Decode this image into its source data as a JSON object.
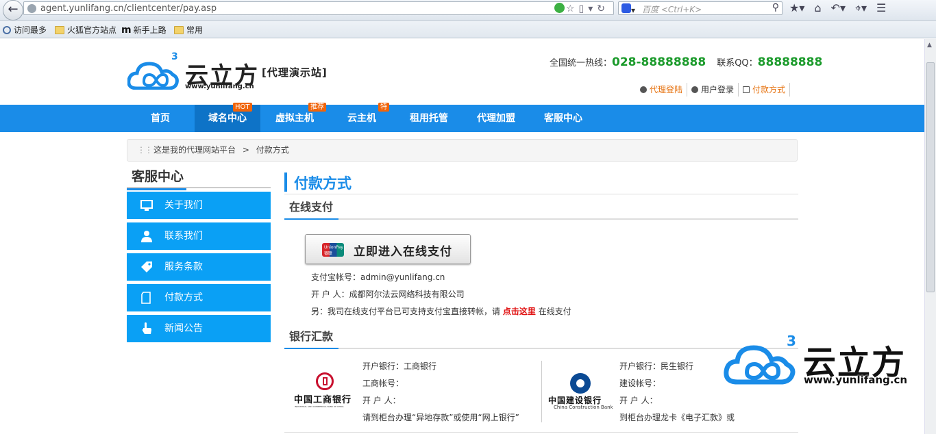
{
  "browser": {
    "url": "agent.yunlifang.cn/clientcenter/pay.asp",
    "search_placeholder": "百度 <Ctrl+K>",
    "bookmarks": [
      "访问最多",
      "火狐官方站点",
      "新手上路",
      "常用"
    ]
  },
  "header": {
    "logo_text": "云立方",
    "logo_url": "www.yunlifang.cn",
    "logo_superscript": "3",
    "tagline": "[代理演示站]",
    "hotline_label": "全国统一热线：",
    "hotline_number": "028-88888888",
    "qq_label": "联系QQ：",
    "qq_number": "88888888",
    "links": [
      "代理登陆",
      "用户登录",
      "付款方式"
    ]
  },
  "nav": {
    "items": [
      "首页",
      "域名中心",
      "虚拟主机",
      "云主机",
      "租用托管",
      "代理加盟",
      "客服中心"
    ],
    "badges": {
      "domain": "HOT",
      "vhost": "推荐",
      "cloud": "特"
    }
  },
  "breadcrumb": {
    "root": "这是我的代理网站平台",
    "separator": ">",
    "current": "付款方式"
  },
  "sidebar": {
    "title": "客服中心",
    "items": [
      {
        "label": "关于我们",
        "icon": "monitor-icon"
      },
      {
        "label": "联系我们",
        "icon": "user-icon"
      },
      {
        "label": "服务条款",
        "icon": "tag-icon"
      },
      {
        "label": "付款方式",
        "icon": "document-icon"
      },
      {
        "label": "新闻公告",
        "icon": "hand-pointer-icon"
      }
    ]
  },
  "main": {
    "title": "付款方式",
    "online": {
      "heading": "在线支付",
      "button_label": "立即进入在线支付",
      "unionpay_text": "UnionPay 银联",
      "alipay_line": "支付宝帐号：admin@yunlifang.cn",
      "holder_line": "开 户 人：成都阿尔法云网络科技有限公司",
      "note_prefix": "另：我司在线支付平台已可支持支付宝直接转帐，请",
      "note_link": "点击这里",
      "note_suffix": "在线支付"
    },
    "bank": {
      "heading": "银行汇款",
      "icbc": {
        "logo_name": "中国工商银行",
        "logo_sub": "INDUSTRIAL AND COMMERCIAL BANK OF CHINA",
        "lines": [
          "开户银行：工商银行",
          "工商帐号：",
          "开 户 人：",
          "请到柜台办理“异地存款”或使用“网上银行”"
        ]
      },
      "ccb": {
        "logo_name": "中国建设银行",
        "logo_sub": "China Construction Bank",
        "lines": [
          "开户银行：民生银行",
          "建设帐号：",
          "开 户 人：",
          "到柜台办理龙卡《电子汇款》或"
        ]
      }
    }
  },
  "watermark": {
    "text": "云立方",
    "url": "www.yunlifang.cn",
    "superscript": "3"
  },
  "colors": {
    "brand_blue": "#1a8ce8",
    "sidebar_blue": "#0aa0f5",
    "hotline_green": "#1a9a2a",
    "link_orange": "#e6700c",
    "link_red": "#e01010"
  }
}
